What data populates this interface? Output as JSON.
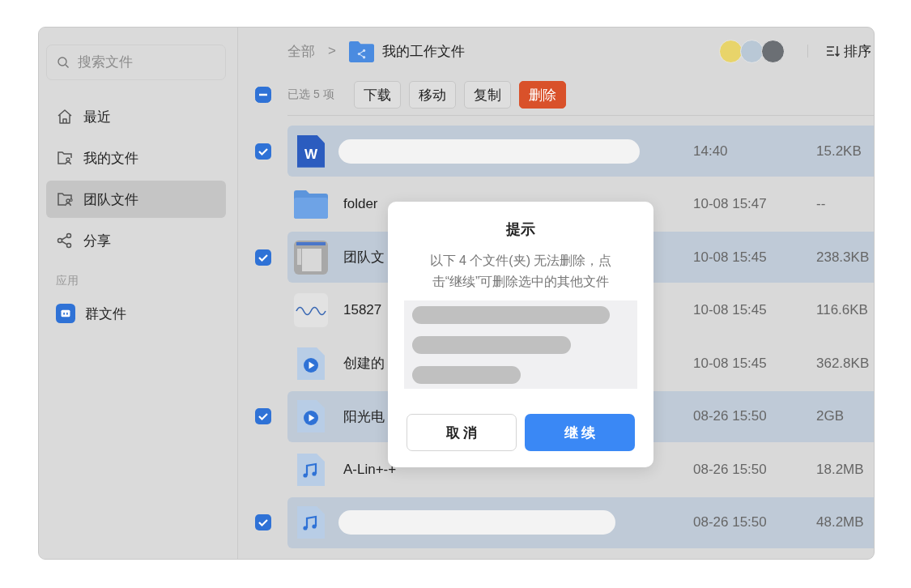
{
  "sidebar": {
    "search": {
      "placeholder": "搜索文件"
    },
    "items": [
      {
        "kind": "home",
        "label": "最近",
        "selected": false
      },
      {
        "kind": "folder-user",
        "label": "我的文件",
        "selected": false
      },
      {
        "kind": "folder-team",
        "label": "团队文件",
        "selected": true
      },
      {
        "kind": "share",
        "label": "分享",
        "selected": false
      }
    ],
    "section_label": "应用",
    "apps": [
      {
        "label": "群文件"
      }
    ]
  },
  "breadcrumb": {
    "root": "全部",
    "separator": ">",
    "current": "我的工作文件"
  },
  "header": {
    "sort_label": "排序",
    "avatars": [
      {
        "color": "#e8d46a"
      },
      {
        "color": "#b9c8d6"
      },
      {
        "color": "#6b6f74"
      }
    ]
  },
  "toolbar": {
    "select_all_indeterminate": true,
    "selection_text": "已选 5 项",
    "buttons": [
      {
        "label": "下载",
        "kind": "normal"
      },
      {
        "label": "移动",
        "kind": "normal"
      },
      {
        "label": "复制",
        "kind": "normal"
      },
      {
        "label": "删除",
        "kind": "danger"
      }
    ]
  },
  "files": [
    {
      "kind": "word",
      "icon_text": "W",
      "redacted": true,
      "time": "14:40",
      "size": "15.2KB",
      "selected": true
    },
    {
      "kind": "folder",
      "name": "folder",
      "time": "10-08 15:47",
      "size": "--",
      "selected": false
    },
    {
      "kind": "screenshot",
      "name": "团队文",
      "time": "10-08 15:45",
      "size": "238.3KB",
      "selected": true
    },
    {
      "kind": "image",
      "name": "15827",
      "time": "10-08 15:45",
      "size": "116.6KB",
      "selected": false
    },
    {
      "kind": "video",
      "name": "创建的",
      "time": "10-08 15:45",
      "size": "362.8KB",
      "selected": false
    },
    {
      "kind": "video",
      "name": "阳光电",
      "time": "08-26 15:50",
      "size": "2GB",
      "selected": true
    },
    {
      "kind": "audio",
      "name": "A-Lin+-+",
      "time": "08-26 15:50",
      "size": "18.2MB",
      "selected": false
    },
    {
      "kind": "audio",
      "redacted": true,
      "time": "08-26 15:50",
      "size": "48.2MB",
      "selected": true
    }
  ],
  "dialog": {
    "title": "提示",
    "message": "以下 4 个文件(夹) 无法删除，点击“继续”可删除选中的其他文件",
    "hidden_items": [
      {
        "redacted": true
      },
      {
        "redacted": true
      },
      {
        "redacted": true
      }
    ],
    "buttons": [
      {
        "label": "取 消",
        "kind": "secondary"
      },
      {
        "label": "继 续",
        "kind": "primary"
      }
    ]
  }
}
